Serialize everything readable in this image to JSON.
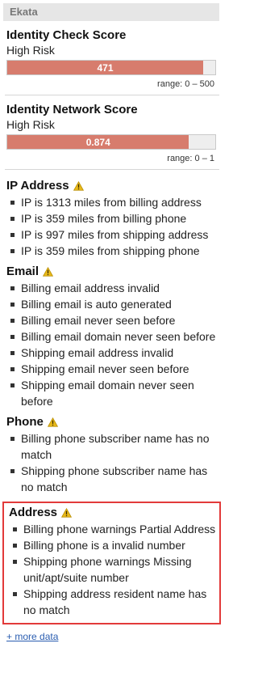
{
  "header": {
    "title": "Ekata"
  },
  "scores": [
    {
      "title": "Identity Check Score",
      "risk": "High Risk",
      "value_label": "471",
      "fill_fraction": 0.942,
      "range": "range: 0 – 500"
    },
    {
      "title": "Identity Network Score",
      "risk": "High Risk",
      "value_label": "0.874",
      "fill_fraction": 0.874,
      "range": "range: 0 – 1"
    }
  ],
  "sections": {
    "ip": {
      "title": "IP Address",
      "icon": "warning-icon",
      "items": [
        "IP is 1313 miles from billing address",
        "IP is 359 miles from billing phone",
        "IP is 997 miles from shipping address",
        "IP is 359 miles from shipping phone"
      ]
    },
    "email": {
      "title": "Email",
      "icon": "warning-icon",
      "items": [
        "Billing email address invalid",
        "Billing email is auto generated",
        "Billing email never seen before",
        "Billing email domain never seen before",
        "Shipping email address invalid",
        "Shipping email never seen before",
        "Shipping email domain never seen before"
      ]
    },
    "phone": {
      "title": "Phone",
      "icon": "warning-icon",
      "items": [
        "Billing phone subscriber name has no match",
        "Shipping phone subscriber name has no match"
      ]
    },
    "address": {
      "title": "Address",
      "icon": "warning-icon",
      "items": [
        "Billing phone warnings Partial Address",
        "Billing phone is a invalid number",
        "Shipping phone warnings Missing unit/apt/suite number",
        "Shipping address resident name has no match"
      ]
    }
  },
  "more_link": "+ more data",
  "colors": {
    "bar_fill": "#d77c6d",
    "highlight_border": "#e23a3a",
    "warning": "#e8b91a",
    "link": "#2a5db0"
  }
}
